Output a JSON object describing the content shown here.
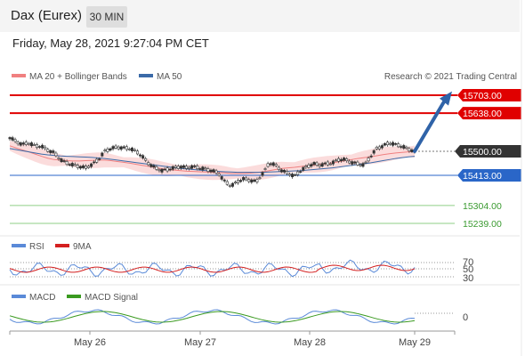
{
  "header": {
    "instrument": "Dax (Eurex)",
    "timeframe": "30 MIN",
    "datetime": "Friday, May 28, 2021 9:27:04 PM CET"
  },
  "legend": {
    "ma20": "MA 20 + Bollinger Bands",
    "ma50": "MA 50",
    "rsi": "RSI",
    "rsi_ma": "9MA",
    "macd": "MACD",
    "macd_signal": "MACD Signal"
  },
  "copyright": "Research © 2021 Trading Central",
  "colors": {
    "resistance": "#e00000",
    "support": "#2a66c8",
    "target": "#3a9a30",
    "arrow": "#2f63a8",
    "ma20": "#f08080",
    "ma50": "#3b6aa8",
    "bollinger": "#fbdcdc",
    "rsi": "#5a8ad8",
    "rsi_ma": "#d42020",
    "macd": "#5a8ad8",
    "macd_signal": "#3a9a20"
  },
  "chart_data": {
    "type": "candlestick",
    "x_ticks": [
      "May 26",
      "May 27",
      "May 28",
      "May 29"
    ],
    "levels": [
      {
        "label": "15703.00",
        "value": 15703,
        "kind": "resistance"
      },
      {
        "label": "15638.00",
        "value": 15638,
        "kind": "resistance"
      },
      {
        "label": "15500.00",
        "value": 15500,
        "kind": "last"
      },
      {
        "label": "15413.00",
        "value": 15413,
        "kind": "pivot"
      },
      {
        "label": "15304.00",
        "value": 15304,
        "kind": "target"
      },
      {
        "label": "15239.00",
        "value": 15239,
        "kind": "target"
      }
    ],
    "price_path": [
      15550,
      15535,
      15525,
      15530,
      15520,
      15518,
      15505,
      15495,
      15470,
      15458,
      15450,
      15445,
      15440,
      15452,
      15470,
      15500,
      15510,
      15515,
      15512,
      15510,
      15500,
      15480,
      15455,
      15440,
      15430,
      15435,
      15440,
      15445,
      15440,
      15445,
      15440,
      15435,
      15430,
      15420,
      15390,
      15375,
      15390,
      15400,
      15395,
      15390,
      15420,
      15458,
      15450,
      15430,
      15420,
      15410,
      15430,
      15445,
      15455,
      15450,
      15455,
      15458,
      15470,
      15470,
      15460,
      15455,
      15450,
      15480,
      15510,
      15520,
      15530,
      15525,
      15518,
      15508,
      15500
    ],
    "ma20": [
      15520,
      15512,
      15505,
      15498,
      15490,
      15482,
      15475,
      15470,
      15468,
      15466,
      15465,
      15465,
      15466,
      15467,
      15468,
      15468,
      15466,
      15463,
      15460,
      15457,
      15453,
      15449,
      15445,
      15441,
      15437,
      15434,
      15432,
      15430,
      15428,
      15427,
      15426,
      15425,
      15424,
      15423,
      15422,
      15420,
      15420,
      15420,
      15421,
      15423,
      15426,
      15430,
      15434,
      15438,
      15440,
      15442,
      15445,
      15448,
      15450,
      15452,
      15455,
      15458,
      15462,
      15466,
      15470,
      15474,
      15477,
      15480,
      15484,
      15488,
      15491,
      15494,
      15496,
      15498,
      15499
    ],
    "ma50": [
      15510,
      15506,
      15502,
      15498,
      15494,
      15490,
      15487,
      15485,
      15483,
      15482,
      15481,
      15480,
      15479,
      15478,
      15476,
      15474,
      15471,
      15468,
      15465,
      15462,
      15459,
      15456,
      15453,
      15450,
      15447,
      15444,
      15441,
      15438,
      15436,
      15434,
      15432,
      15430,
      15428,
      15427,
      15426,
      15425,
      15424,
      15424,
      15424,
      15424,
      15424,
      15425,
      15426,
      15427,
      15428,
      15429,
      15430,
      15432,
      15434,
      15436,
      15438,
      15440,
      15443,
      15446,
      15449,
      15452,
      15455,
      15458,
      15462,
      15466,
      15470,
      15474,
      15477,
      15480,
      15482
    ],
    "rsi_levels": [
      "70",
      "50",
      "30"
    ],
    "macd_levels": [
      "0"
    ]
  }
}
